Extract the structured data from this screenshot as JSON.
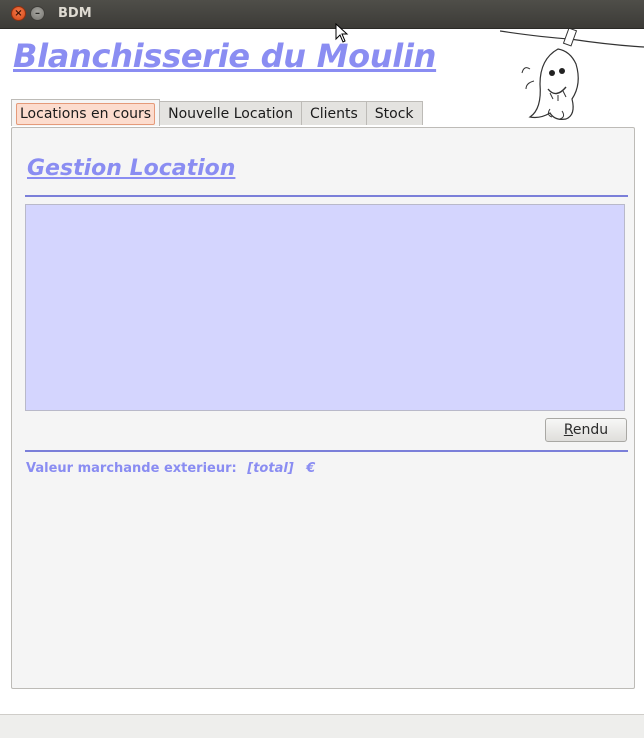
{
  "window": {
    "title": "BDM"
  },
  "app": {
    "title": "Blanchisserie du Moulin"
  },
  "tabs": [
    {
      "label": "Locations en cours",
      "active": true
    },
    {
      "label": "Nouvelle Location",
      "active": false
    },
    {
      "label": "Clients",
      "active": false
    },
    {
      "label": "Stock",
      "active": false
    }
  ],
  "section": {
    "title": "Gestion Location"
  },
  "actions": {
    "rendu_first": "R",
    "rendu_rest": "endu"
  },
  "totals": {
    "label": "Valeur marchande exterieur:",
    "value": "[total]",
    "currency": "€"
  },
  "colors": {
    "accent": "#8a8df2",
    "list_bg": "#d4d5fe",
    "active_tab_highlight": "#fcdcce"
  },
  "icons": {
    "close": "close-icon",
    "minimize": "minimize-icon",
    "cursor": "mouse-pointer-icon",
    "mascot": "laundry-mascot-illustration"
  }
}
